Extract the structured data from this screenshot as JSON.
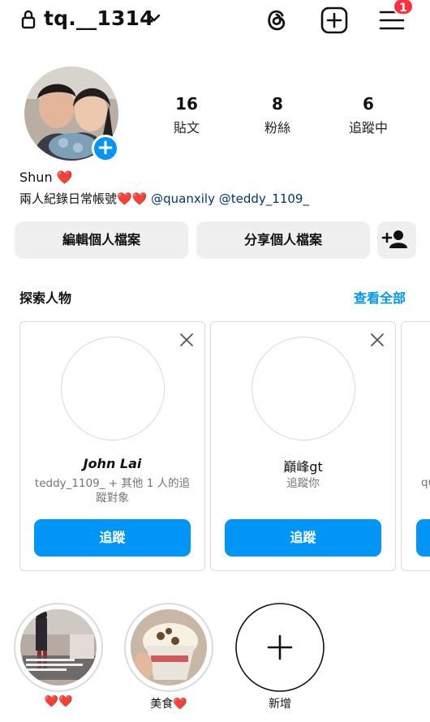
{
  "header": {
    "username": "tq.__1314",
    "notification_count": "1"
  },
  "stats": [
    {
      "value": "16",
      "label": "貼文"
    },
    {
      "value": "8",
      "label": "粉絲"
    },
    {
      "value": "6",
      "label": "追蹤中"
    }
  ],
  "profile": {
    "name_text": "Shun",
    "name_emoji": "❤️",
    "bio_text": "兩人紀錄日常帳號",
    "bio_emoji": "❤️❤️",
    "mentions": [
      "@quanxily",
      "@teddy_1109_"
    ]
  },
  "buttons": {
    "edit_profile": "編輯個人檔案",
    "share_profile": "分享個人檔案"
  },
  "discover": {
    "title": "探索人物",
    "see_all": "查看全部",
    "cards": [
      {
        "name": "John Lai",
        "subtitle": "teddy_1109_ + 其他 1 人的追蹤對象",
        "follow_label": "追蹤"
      },
      {
        "name": "巔峰gt",
        "subtitle": "追蹤你",
        "follow_label": "追蹤"
      },
      {
        "subtitle_fragment": "qu"
      }
    ]
  },
  "highlights": [
    {
      "label": "❤️❤️"
    },
    {
      "label": "美食❤️"
    },
    {
      "label": "新增"
    }
  ],
  "colors": {
    "accent": "#0095f6",
    "badge": "#ff3040",
    "button_bg": "#efefef",
    "mention": "#00376b"
  }
}
